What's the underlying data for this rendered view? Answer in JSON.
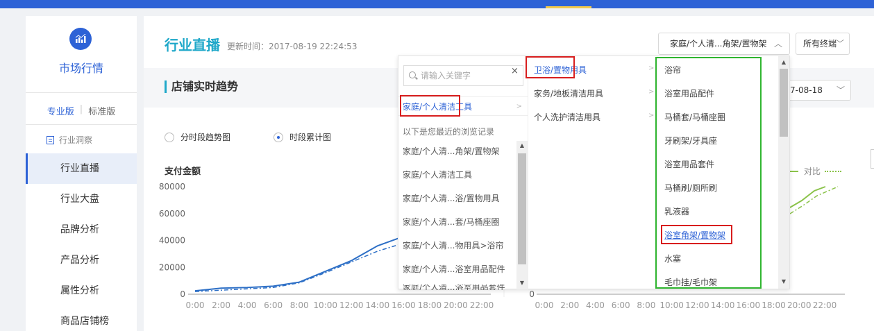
{
  "sidebar": {
    "title": "市场行情",
    "version_active": "专业版",
    "version_other": "标准版",
    "group_label": "行业洞察",
    "items": [
      {
        "label": "行业直播",
        "active": true
      },
      {
        "label": "行业大盘"
      },
      {
        "label": "品牌分析"
      },
      {
        "label": "产品分析"
      },
      {
        "label": "属性分析"
      },
      {
        "label": "商品店铺榜"
      }
    ]
  },
  "header": {
    "title": "行业直播",
    "update_time": "更新时间：2017-08-19 22:24:53",
    "category_select": "家庭/个人清...角架/置物架",
    "terminal_select": "所有终端"
  },
  "section": {
    "title": "店铺实时趋势",
    "date_value": "7-08-18"
  },
  "view_toggle": {
    "option1": "分时段趋势图",
    "option2": "时段累计图",
    "selected": "时段累计图"
  },
  "chart_data": [
    {
      "type": "line",
      "title": "",
      "ylabel": "支付金额",
      "x": [
        "0:00",
        "2:00",
        "4:00",
        "6:00",
        "8:00",
        "10:00",
        "12:00",
        "14:00",
        "16:00",
        "18:00",
        "20:00",
        "22:00"
      ],
      "ylim": [
        0,
        80000
      ],
      "yticks": [
        "80000",
        "60000",
        "40000",
        "20000",
        "0"
      ],
      "series": [
        {
          "name": "",
          "style": "solid",
          "color": "#2d6fc6",
          "points": [
            [
              0,
              2500
            ],
            [
              1,
              4500
            ],
            [
              2,
              5000
            ],
            [
              3,
              6000
            ],
            [
              4,
              9000
            ],
            [
              5,
              17000
            ],
            [
              6,
              25000
            ],
            [
              7,
              36000
            ],
            [
              8,
              43000
            ]
          ]
        },
        {
          "name": "",
          "style": "dashdot",
          "color": "#2d6fc6",
          "points": [
            [
              0,
              2000
            ],
            [
              1,
              3000
            ],
            [
              2,
              4000
            ],
            [
              3,
              5000
            ],
            [
              4,
              8500
            ],
            [
              5,
              16000
            ],
            [
              6,
              24000
            ],
            [
              7,
              32000
            ],
            [
              8,
              38000
            ]
          ]
        }
      ]
    },
    {
      "type": "line",
      "title": "",
      "x": [
        "0:00",
        "2:00",
        "4:00",
        "6:00",
        "8:00",
        "10:00",
        "12:00",
        "14:00",
        "16:00",
        "18:00",
        "20:00",
        "22:00"
      ],
      "yticks": [
        "0"
      ],
      "legend": [
        "对比"
      ],
      "series": [
        {
          "name": "",
          "style": "solid",
          "color": "#8bc34a",
          "points": []
        },
        {
          "name": "对比",
          "style": "dashdot",
          "color": "#8bc34a",
          "points": []
        }
      ]
    }
  ],
  "dropdown": {
    "search_placeholder": "请输入关键字",
    "clear": "×",
    "level1_selected": "家庭/个人清洁工具",
    "recent_label": "以下是您最近的浏览记录",
    "recent": [
      "家庭/个人清...角架/置物架",
      "家庭/个人清洁工具",
      "家庭/个人清...浴/置物用具",
      "家庭/个人清...套/马桶座圈",
      "家庭/个人清...物用具>浴帘",
      "家庭/个人清...浴室用品配件",
      "家庭/个人清...浴室用品套件"
    ],
    "level2": [
      "卫浴/置物用具",
      "家务/地板清洁用具",
      "个人洗护清洁用具"
    ],
    "level2_selected": "卫浴/置物用具",
    "level3": [
      "浴帘",
      "浴室用品配件",
      "马桶套/马桶座圈",
      "牙刷架/牙具座",
      "浴室用品套件",
      "马桶刷/厕所刷",
      "乳液器",
      "浴室角架/置物架",
      "水塞",
      "毛巾挂/毛巾架"
    ],
    "level3_selected": "浴室角架/置物架",
    "arrow": ">"
  }
}
